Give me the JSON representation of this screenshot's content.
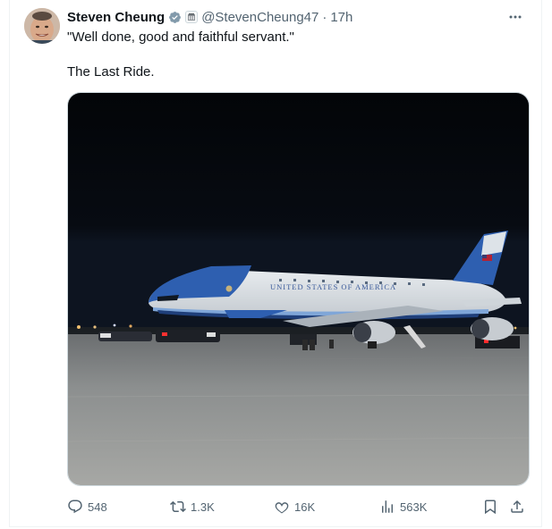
{
  "tweet": {
    "author_name": "Steven Cheung",
    "handle": "@StevenCheung47",
    "separator": "·",
    "time": "17h",
    "text_line_1": "\"Well done, good and faithful servant.\"",
    "text_line_2": "The Last Ride.",
    "media": {
      "fuselage_text": "UNITED STATES OF AMERICA"
    }
  },
  "actions": {
    "replies": "548",
    "reposts": "1.3K",
    "likes": "16K",
    "views": "563K"
  },
  "icons": {
    "more": "more-horizontal-icon",
    "reply": "reply-icon",
    "repost": "repost-icon",
    "like": "heart-icon",
    "views": "analytics-icon",
    "bookmark": "bookmark-icon",
    "share": "share-icon",
    "verified": "verified-badge-icon",
    "affiliate": "affiliate-badge-icon"
  },
  "colors": {
    "text_primary": "#0f1419",
    "text_secondary": "#536471",
    "verified_badge": "#829aab"
  }
}
